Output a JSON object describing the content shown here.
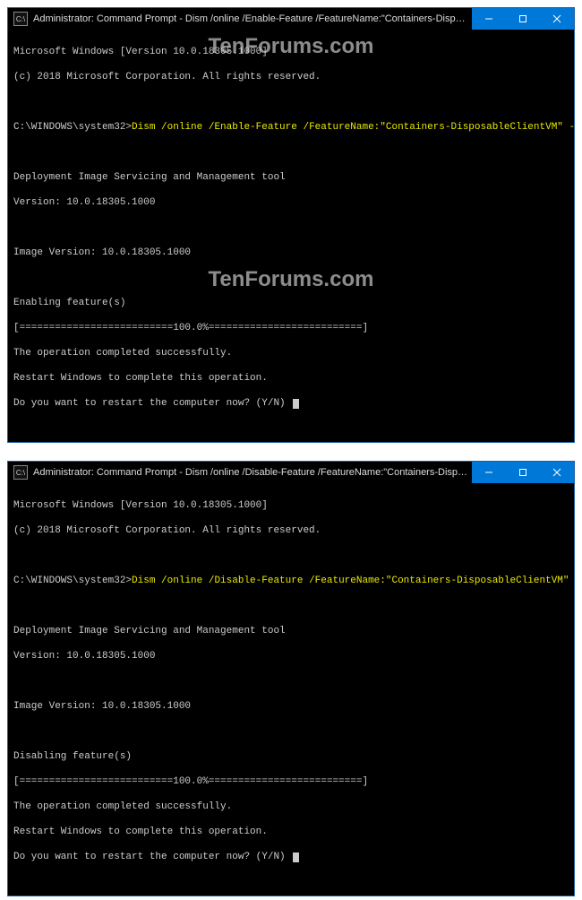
{
  "watermark": "TenForums.com",
  "icon_label": "C:\\",
  "windows": [
    {
      "title": "Administrator: Command Prompt - Dism  /online /Enable-Feature /FeatureName:\"Containers-DisposableClientVM\" -All",
      "header1": "Microsoft Windows [Version 10.0.18305.1000]",
      "header2": "(c) 2018 Microsoft Corporation. All rights reserved.",
      "prompt": "C:\\WINDOWS\\system32>",
      "command": "Dism /online /Enable-Feature /FeatureName:\"Containers-DisposableClientVM\" -All",
      "tool": "Deployment Image Servicing and Management tool",
      "version": "Version: 10.0.18305.1000",
      "image_version": "Image Version: 10.0.18305.1000",
      "action": "Enabling feature(s)",
      "progress": "[==========================100.0%==========================]",
      "success": "The operation completed successfully.",
      "restart_msg": "Restart Windows to complete this operation.",
      "restart_prompt": "Do you want to restart the computer now? (Y/N) "
    },
    {
      "title": "Administrator: Command Prompt - Dism  /online /Disable-Feature /FeatureName:\"Containers-DisposableClientVM\"",
      "header1": "Microsoft Windows [Version 10.0.18305.1000]",
      "header2": "(c) 2018 Microsoft Corporation. All rights reserved.",
      "prompt": "C:\\WINDOWS\\system32>",
      "command": "Dism /online /Disable-Feature /FeatureName:\"Containers-DisposableClientVM\"",
      "tool": "Deployment Image Servicing and Management tool",
      "version": "Version: 10.0.18305.1000",
      "image_version": "Image Version: 10.0.18305.1000",
      "action": "Disabling feature(s)",
      "progress": "[==========================100.0%==========================]",
      "success": "The operation completed successfully.",
      "restart_msg": "Restart Windows to complete this operation.",
      "restart_prompt": "Do you want to restart the computer now? (Y/N) "
    }
  ]
}
